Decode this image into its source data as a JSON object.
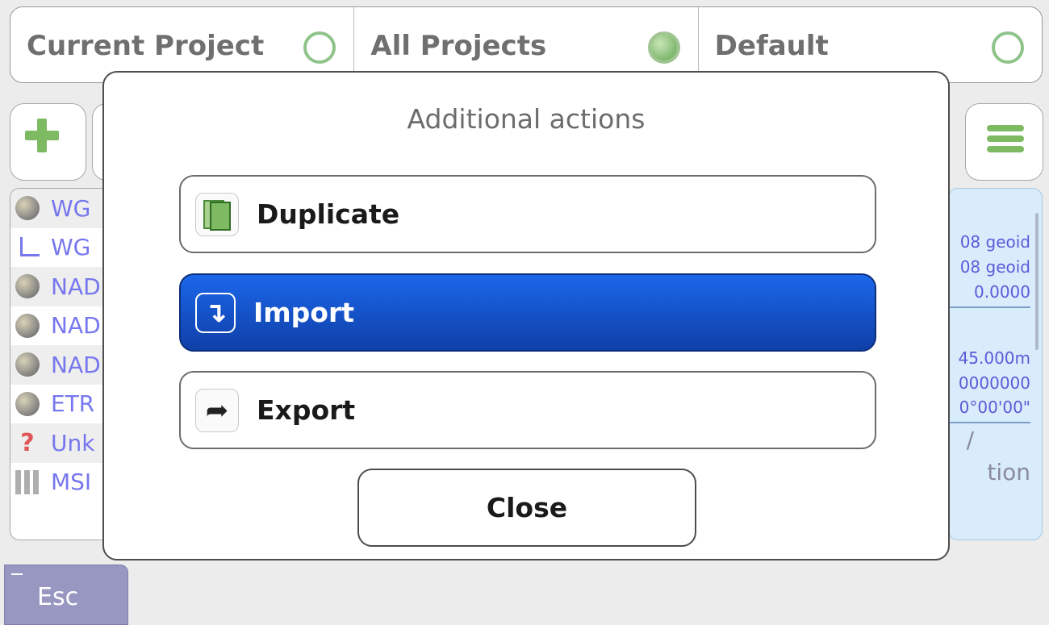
{
  "tabs": [
    {
      "label": "Current Project",
      "selected": false
    },
    {
      "label": "All Projects",
      "selected": true
    },
    {
      "label": "Default",
      "selected": false
    }
  ],
  "list": [
    {
      "icon": "globe-icon",
      "text": "WG"
    },
    {
      "icon": "axes-icon",
      "text": "WG"
    },
    {
      "icon": "globe-icon",
      "text": "NAD"
    },
    {
      "icon": "globe-icon",
      "text": "NAD"
    },
    {
      "icon": "globe-icon",
      "text": "NAD"
    },
    {
      "icon": "globe-icon",
      "text": "ETR"
    },
    {
      "icon": "question-icon",
      "text": "Unk"
    },
    {
      "icon": "grid-icon",
      "text": "MSI"
    }
  ],
  "info": {
    "line1": "08 geoid",
    "line2": "08 geoid",
    "line3": "0.0000",
    "line4": "45.000m",
    "line5": "0000000",
    "line6": "0°00'00\"",
    "line7": "/",
    "line8": "tion"
  },
  "esc_label": "Esc",
  "dialog": {
    "title": "Additional actions",
    "actions": [
      {
        "label": "Duplicate",
        "icon": "duplicate-icon"
      },
      {
        "label": "Import",
        "icon": "import-icon",
        "active": true
      },
      {
        "label": "Export",
        "icon": "export-icon"
      }
    ],
    "close_label": "Close"
  },
  "colors": {
    "accent": "#1c67ea",
    "link": "#7777ee",
    "radio_green": "#7fb86f"
  }
}
